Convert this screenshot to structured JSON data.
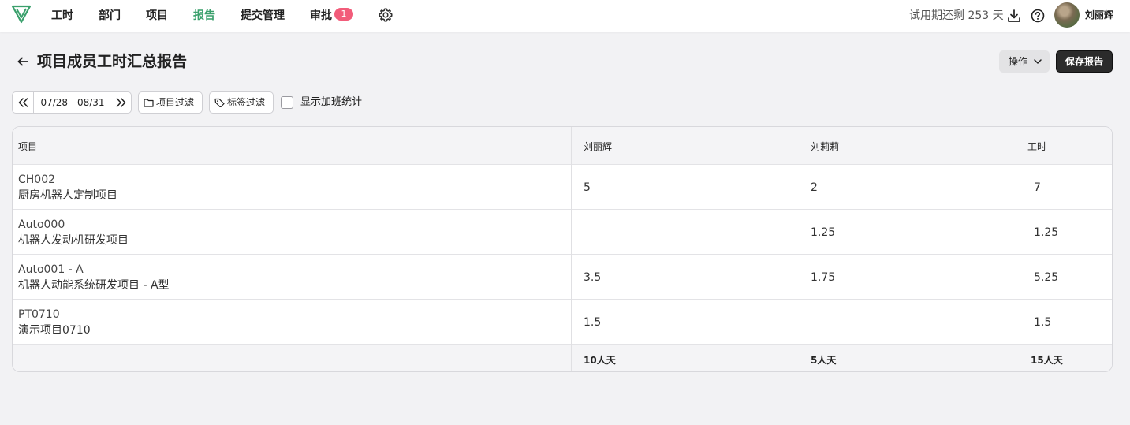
{
  "nav": {
    "items": [
      {
        "label": "工时",
        "active": false
      },
      {
        "label": "部门",
        "active": false
      },
      {
        "label": "项目",
        "active": false
      },
      {
        "label": "报告",
        "active": true
      },
      {
        "label": "提交管理",
        "active": false
      },
      {
        "label": "审批",
        "active": false
      }
    ],
    "approval_badge": "1",
    "trial_text": "试用期还剩 253 天",
    "user_name": "刘丽辉"
  },
  "colors": {
    "accent": "#3aa06c",
    "badge": "#f25c7a",
    "primary_button": "#2b2b2b"
  },
  "icons": [
    "logo-icon",
    "gear-icon",
    "download-icon",
    "help-icon",
    "back-arrow-icon",
    "chevron-down-icon",
    "double-chevron-left-icon",
    "double-chevron-right-icon",
    "folder-icon",
    "tag-icon"
  ],
  "header": {
    "title": "项目成员工时汇总报告",
    "ops_label": "操作",
    "save_label": "保存报告"
  },
  "filters": {
    "date_range": "07/28 - 08/31",
    "project_filter": "项目过滤",
    "tag_filter": "标签过滤",
    "overtime_label": "显示加班统计",
    "overtime_checked": false
  },
  "table": {
    "headers": [
      "项目",
      "刘丽辉",
      "刘莉莉",
      "工时"
    ],
    "rows": [
      {
        "code": "CH002",
        "name": "厨房机器人定制项目",
        "liulihui": "5",
        "liulili": "2",
        "total": "7"
      },
      {
        "code": "Auto000",
        "name": "机器人发动机研发项目",
        "liulihui": "",
        "liulili": "1.25",
        "total": "1.25"
      },
      {
        "code": "Auto001 - A",
        "name": "机器人动能系统研发项目 - A型",
        "liulihui": "3.5",
        "liulili": "1.75",
        "total": "5.25"
      },
      {
        "code": "PT0710",
        "name": "演示项目0710",
        "liulihui": "1.5",
        "liulili": "",
        "total": "1.5"
      }
    ],
    "footer": {
      "project": "",
      "liulihui": "10人天",
      "liulili": "5人天",
      "total": "15人天"
    }
  }
}
